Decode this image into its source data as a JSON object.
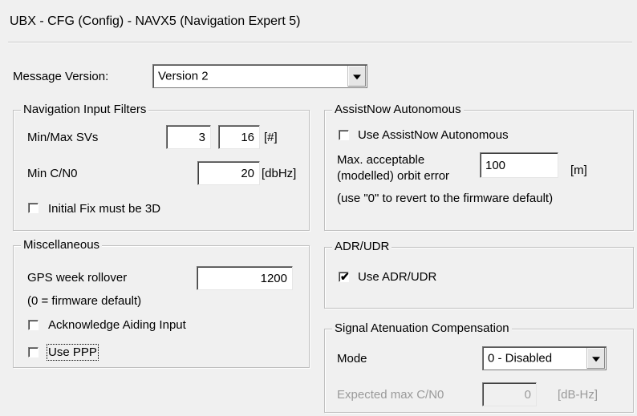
{
  "title": "UBX - CFG (Config) - NAVX5 (Navigation Expert 5)",
  "message_version": {
    "label": "Message Version:",
    "value": "Version 2"
  },
  "nav_input_filters": {
    "legend": "Navigation Input Filters",
    "min_max_svs_label": "Min/Max SVs",
    "min_svs": "3",
    "max_svs": "16",
    "svs_unit": "[#]",
    "min_cno_label": "Min C/N0",
    "min_cno": "20",
    "cno_unit": "[dbHz]",
    "initial_fix_3d_label": "Initial Fix must be 3D",
    "initial_fix_3d_checked": false
  },
  "misc": {
    "legend": "Miscellaneous",
    "gps_week_rollover_label": "GPS week rollover",
    "gps_week_rollover": "1200",
    "firmware_default_note": "(0 = firmware default)",
    "ack_aiding_label": "Acknowledge Aiding Input",
    "ack_aiding_checked": false,
    "use_ppp_label": "Use PPP",
    "use_ppp_checked": false
  },
  "assistnow": {
    "legend": "AssistNow Autonomous",
    "use_label": "Use AssistNow Autonomous",
    "use_checked": false,
    "max_orbit_label_1": "Max. acceptable",
    "max_orbit_label_2": "(modelled) orbit error",
    "max_orbit_value": "100",
    "max_orbit_unit": "[m]",
    "revert_note": "(use \"0\" to revert to the firmware default)"
  },
  "adr_udr": {
    "legend": "ADR/UDR",
    "use_label": "Use ADR/UDR",
    "use_checked": true
  },
  "signal_atten": {
    "legend": "Signal Atenuation Compensation",
    "mode_label": "Mode",
    "mode_value": "0 - Disabled",
    "expected_label": "Expected max C/N0",
    "expected_value": "0",
    "expected_unit": "[dB-Hz]"
  },
  "checkmark_glyph": "✔"
}
